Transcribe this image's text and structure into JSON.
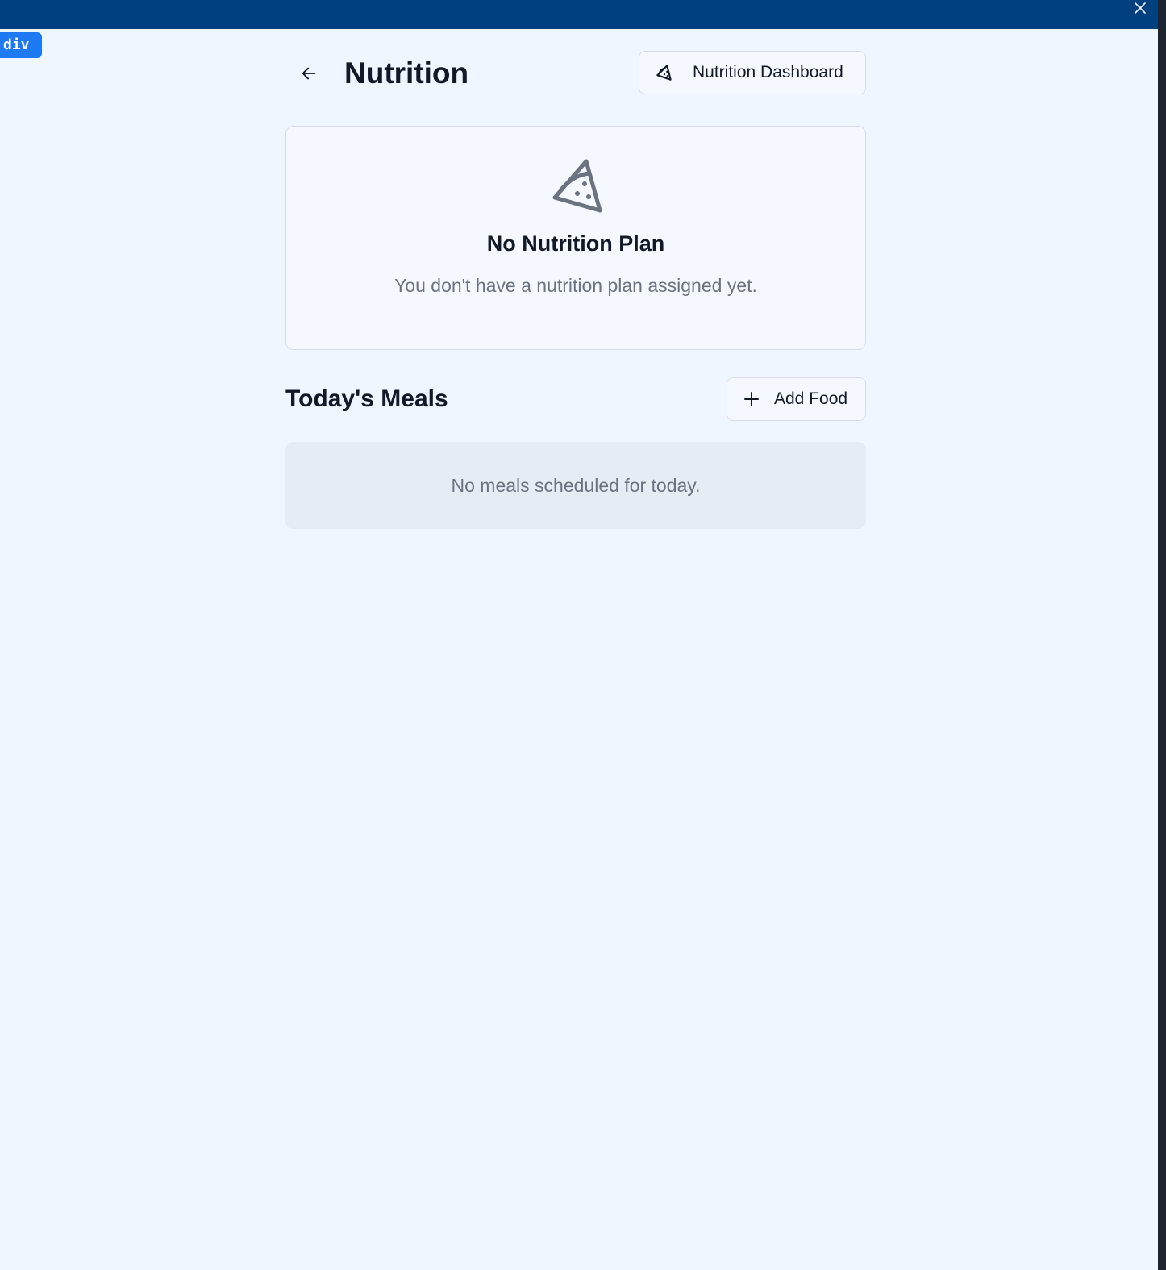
{
  "window": {
    "close_icon": "close-icon"
  },
  "devtools": {
    "badge_label": "div"
  },
  "header": {
    "back_icon": "arrow-left-icon",
    "title": "Nutrition",
    "dashboard_button_label": "Nutrition Dashboard",
    "dashboard_button_icon": "pizza-icon"
  },
  "plan_card": {
    "icon": "pizza-icon",
    "title": "No Nutrition Plan",
    "description": "You don't have a nutrition plan assigned yet."
  },
  "meals": {
    "title": "Today's Meals",
    "add_button_label": "Add Food",
    "add_button_icon": "plus-icon",
    "empty_message": "No meals scheduled for today."
  },
  "colors": {
    "topbar": "#004080",
    "background": "#eff6ff",
    "card_border": "#d9dee6",
    "muted_text": "#6b7280",
    "empty_panel": "#e6ecf3",
    "badge": "#1d7af2"
  }
}
